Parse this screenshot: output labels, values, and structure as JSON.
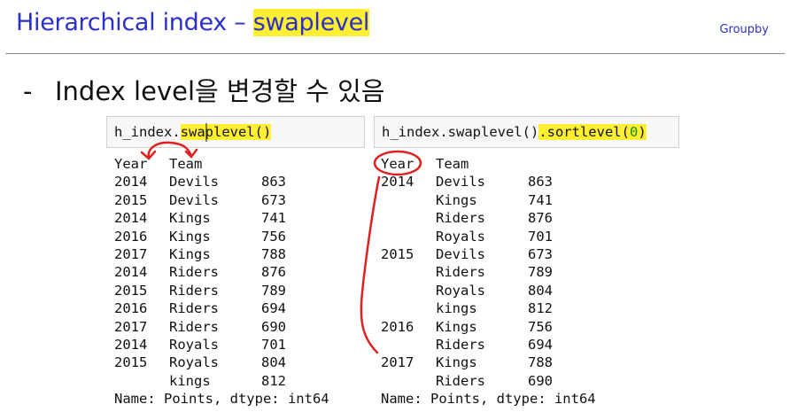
{
  "header": {
    "title_prefix": "Hierarchical index – ",
    "title_highlight": "swaplevel",
    "section": "Groupby"
  },
  "bullet": {
    "dash": "-",
    "text": "Index level을 변경할 수 있음"
  },
  "left_cell": {
    "code_prefix": "h_index.",
    "code_highlight": "swaplevel()",
    "headers": [
      "Year",
      "Team"
    ],
    "rows": [
      [
        "2014",
        "Devils",
        "863"
      ],
      [
        "2015",
        "Devils",
        "673"
      ],
      [
        "2014",
        "Kings",
        "741"
      ],
      [
        "2016",
        "Kings",
        "756"
      ],
      [
        "2017",
        "Kings",
        "788"
      ],
      [
        "2014",
        "Riders",
        "876"
      ],
      [
        "2015",
        "Riders",
        "789"
      ],
      [
        "2016",
        "Riders",
        "694"
      ],
      [
        "2017",
        "Riders",
        "690"
      ],
      [
        "2014",
        "Royals",
        "701"
      ],
      [
        "2015",
        "Royals",
        "804"
      ],
      [
        "",
        "kings",
        "812"
      ]
    ],
    "footer": "Name: Points, dtype: int64"
  },
  "right_cell": {
    "code_prefix": "h_index.swaplevel()",
    "code_highlight_start": ".sortlevel(",
    "code_highlight_arg": "0",
    "code_highlight_end": ")",
    "headers": [
      "Year",
      "Team"
    ],
    "rows": [
      [
        "2014",
        "Devils",
        "863"
      ],
      [
        "",
        "Kings",
        "741"
      ],
      [
        "",
        "Riders",
        "876"
      ],
      [
        "",
        "Royals",
        "701"
      ],
      [
        "2015",
        "Devils",
        "673"
      ],
      [
        "",
        "Riders",
        "789"
      ],
      [
        "",
        "Royals",
        "804"
      ],
      [
        "",
        "kings",
        "812"
      ],
      [
        "2016",
        "Kings",
        "756"
      ],
      [
        "",
        "Riders",
        "694"
      ],
      [
        "2017",
        "Kings",
        "788"
      ],
      [
        "",
        "Riders",
        "690"
      ]
    ],
    "footer": "Name: Points, dtype: int64"
  },
  "annotation_color": "#e02020",
  "highlight_color": "#ffef33"
}
